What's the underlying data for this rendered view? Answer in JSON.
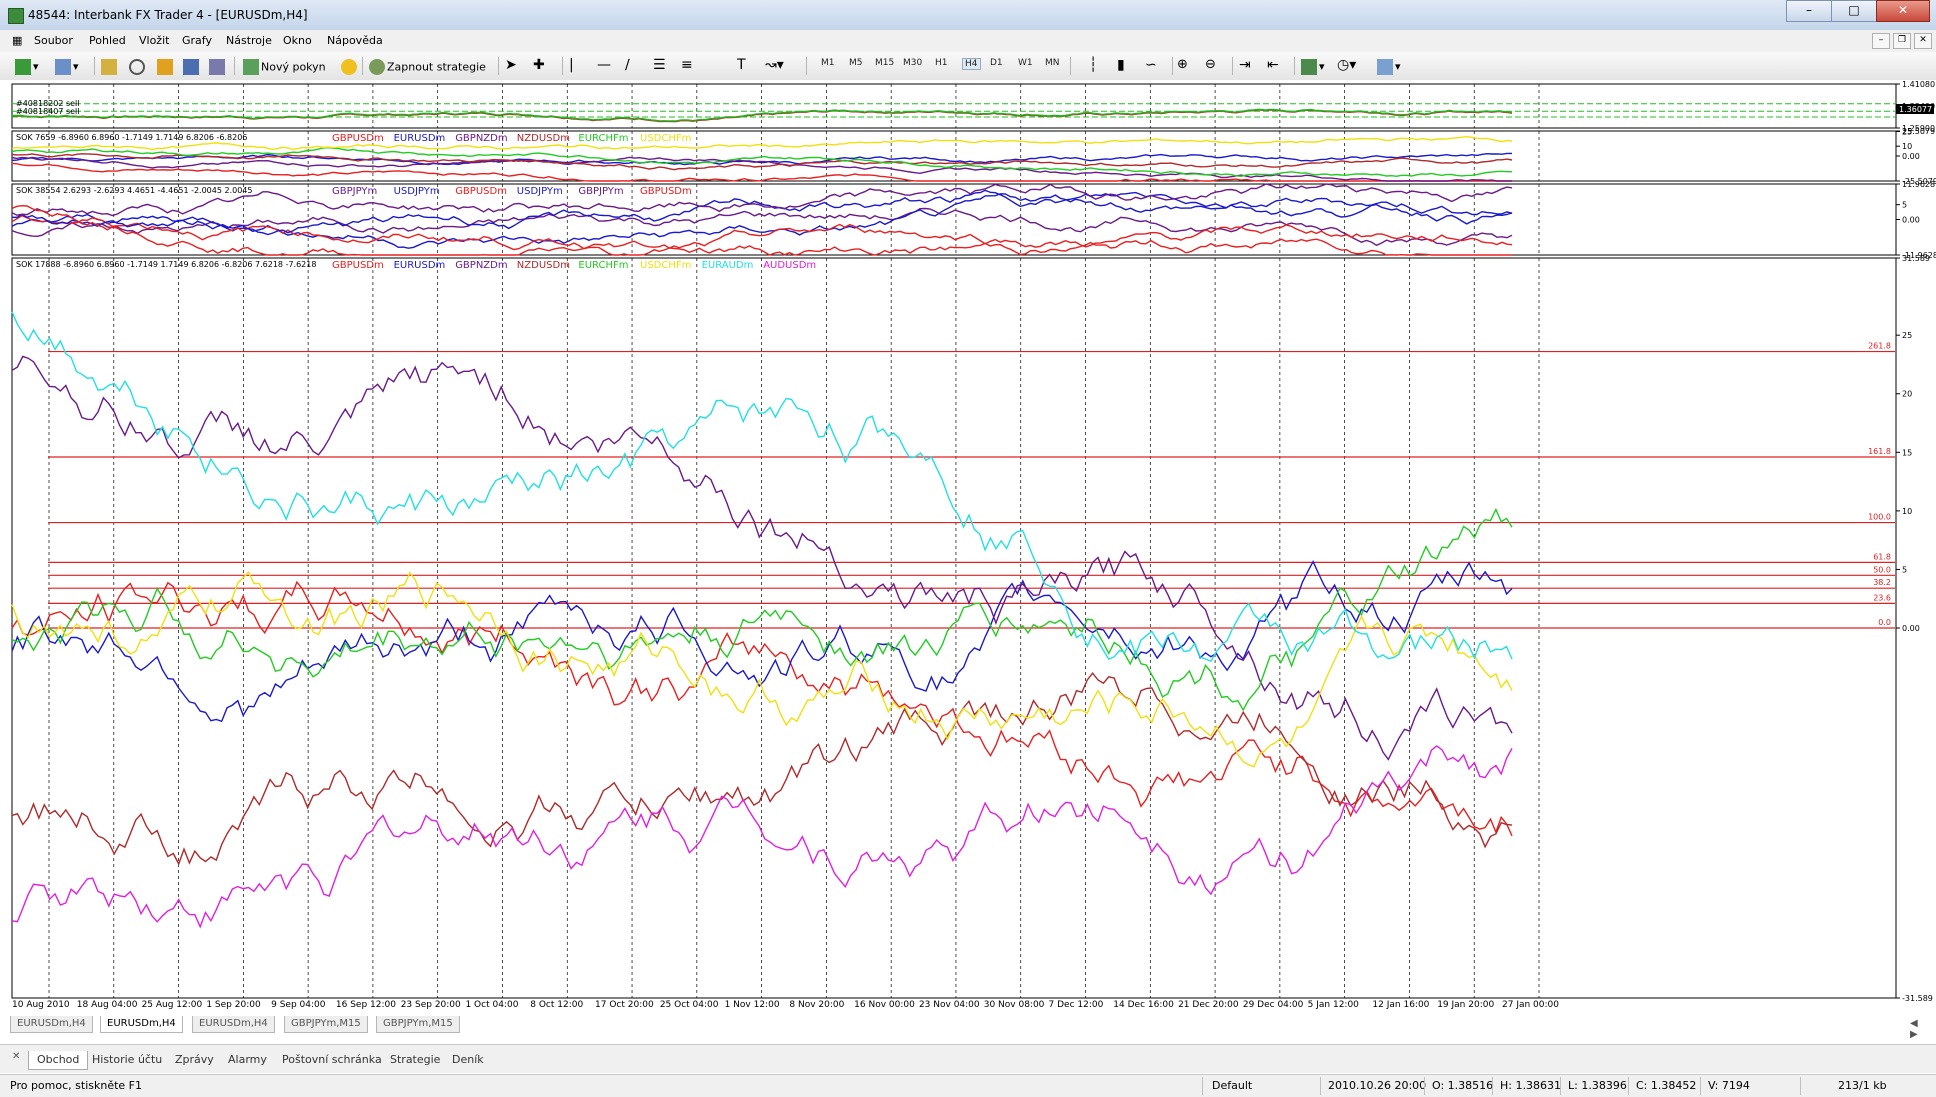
{
  "window": {
    "title": "48544: Interbank FX Trader 4 - [EURUSDm,H4]"
  },
  "menu": [
    "Soubor",
    "Pohled",
    "Vložit",
    "Grafy",
    "Nástroje",
    "Okno",
    "Nápověda"
  ],
  "toolbar": {
    "new_order": "Nový pokyn",
    "strategies": "Zapnout strategie",
    "timeframes": [
      "M1",
      "M5",
      "M15",
      "M30",
      "H1",
      "H4",
      "D1",
      "W1",
      "MN"
    ]
  },
  "chart_data": [
    {
      "type": "line",
      "panel": "main-price",
      "title": "",
      "ylim": [
        1.259,
        1.4108
      ],
      "ticks": [
        "1.41080",
        "1.33490",
        "1.25900"
      ],
      "price_label": "1.36077",
      "trade_labels": [
        "#40818202 sell",
        "#40818407 sell"
      ]
    },
    {
      "type": "line",
      "panel": "indicator-1",
      "header": "SOK 7659 -6.8960 6.8960 -1.7149 1.7149 6.8206 -6.8206",
      "ylim": [
        -25.5079,
        25.5079
      ],
      "ticks": [
        "25.5079",
        "25",
        "10",
        "0.00",
        "-25.5079"
      ],
      "series": [
        {
          "name": "GBPUSDm",
          "color": "#e82020"
        },
        {
          "name": "EURUSDm",
          "color": "#1a1acc"
        },
        {
          "name": "GBPNZDm",
          "color": "#6a1a8a"
        },
        {
          "name": "NZDUSDm",
          "color": "#b02a2a"
        },
        {
          "name": "EURCHFm",
          "color": "#22cc22"
        },
        {
          "name": "USDCHFm",
          "color": "#f0e010"
        }
      ]
    },
    {
      "type": "line",
      "panel": "indicator-2",
      "header": "SOK 38554 2.6293 -2.6293 4.4651 -4.4651 -2.0045 2.0045",
      "ylim": [
        -11.9628,
        11.9628
      ],
      "ticks": [
        "11.9628",
        "5",
        "0.00",
        "-11.9628"
      ],
      "series": [
        {
          "name": "GBPJPYm",
          "color": "#6a1a8a"
        },
        {
          "name": "USDJPYm",
          "color": "#1a1acc"
        },
        {
          "name": "GBPUSDm",
          "color": "#e82020"
        },
        {
          "name": "USDJPYm",
          "color": "#1a1acc"
        },
        {
          "name": "GBPJPYm",
          "color": "#6a1a8a"
        },
        {
          "name": "GBPUSDm",
          "color": "#e82020"
        }
      ]
    },
    {
      "type": "line",
      "panel": "indicator-3",
      "header": "SOK 17888 -6.8960 6.8960 -1.7149 1.7149 6.8206 -6.8206 7.6218 -7.6218",
      "ylim": [
        -31.589,
        31.589
      ],
      "ticks": [
        "31.589",
        "25",
        "20",
        "15",
        "10",
        "5",
        "0.00",
        "-31.589"
      ],
      "fib_levels": [
        {
          "label": "261.8",
          "value": 23.6
        },
        {
          "label": "161.8",
          "value": 14.6
        },
        {
          "label": "100.0",
          "value": 9.0
        },
        {
          "label": "61.8",
          "value": 5.6
        },
        {
          "label": "50.0",
          "value": 4.5
        },
        {
          "label": "38.2",
          "value": 3.4
        },
        {
          "label": "23.6",
          "value": 2.1
        },
        {
          "label": "0.0",
          "value": 0.0
        }
      ],
      "series": [
        {
          "name": "GBPUSDm",
          "color": "#e82020"
        },
        {
          "name": "EURUSDm",
          "color": "#1a1acc"
        },
        {
          "name": "GBPNZDm",
          "color": "#6a1a8a"
        },
        {
          "name": "NZDUSDm",
          "color": "#b02a2a"
        },
        {
          "name": "EURCHFm",
          "color": "#22cc22"
        },
        {
          "name": "USDCHFm",
          "color": "#f0e010"
        },
        {
          "name": "EURAUDm",
          "color": "#22e0e0"
        },
        {
          "name": "AUDUSDm",
          "color": "#e020e0"
        }
      ]
    }
  ],
  "x_axis": [
    "10 Aug 2010",
    "18 Aug 04:00",
    "25 Aug 12:00",
    "1 Sep 20:00",
    "9 Sep 04:00",
    "16 Sep 12:00",
    "23 Sep 20:00",
    "1 Oct 04:00",
    "8 Oct 12:00",
    "17 Oct 20:00",
    "25 Oct 04:00",
    "1 Nov 12:00",
    "8 Nov 20:00",
    "16 Nov 00:00",
    "23 Nov 04:00",
    "30 Nov 08:00",
    "7 Dec 12:00",
    "14 Dec 16:00",
    "21 Dec 20:00",
    "29 Dec 04:00",
    "5 Jan 12:00",
    "12 Jan 16:00",
    "19 Jan 20:00",
    "27 Jan 00:00"
  ],
  "chart_tabs": [
    "EURUSDm,H4",
    "EURUSDm,H4",
    "EURUSDm,H4",
    "GBPJPYm,M15",
    "GBPJPYm,M15"
  ],
  "active_chart_tab": 1,
  "terminal_tabs": [
    "Obchod",
    "Historie účtu",
    "Zprávy",
    "Alarmy",
    "Poštovní schránka",
    "Strategie",
    "Deník"
  ],
  "status": {
    "help": "Pro pomoc, stiskněte F1",
    "profile": "Default",
    "time": "2010.10.26 20:00",
    "open": "O: 1.38516",
    "high": "H: 1.38631",
    "low": "L: 1.38396",
    "close": "C: 1.38452",
    "volume": "V: 7194",
    "traffic": "213/1 kb"
  }
}
